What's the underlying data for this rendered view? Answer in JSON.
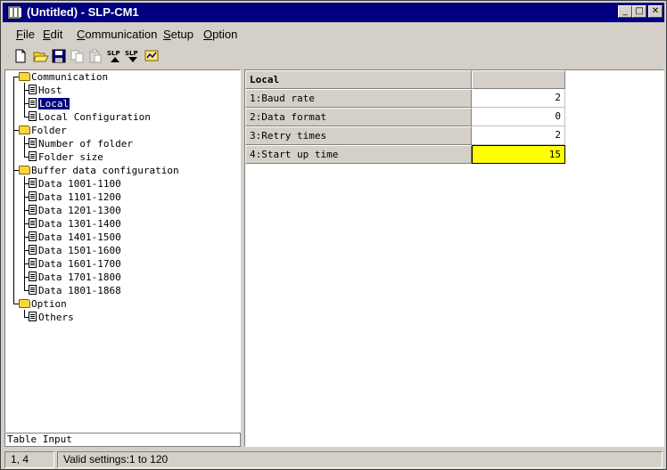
{
  "window": {
    "title": "(Untitled) - SLP-CM1",
    "app_icon": "app-icon",
    "buttons": {
      "minimize": "_",
      "maximize": "□",
      "close": "✕"
    }
  },
  "menu": {
    "items": [
      {
        "accel": "F",
        "rest": "ile"
      },
      {
        "accel": "E",
        "rest": "dit"
      },
      {
        "accel": "C",
        "rest": "ommunication"
      },
      {
        "accel": "S",
        "rest": "etup"
      },
      {
        "accel": "O",
        "rest": "ption"
      }
    ]
  },
  "toolbar": {
    "icons": [
      "new-file-icon",
      "open-folder-icon",
      "save-disk-icon",
      "copy-icon",
      "paste-icon",
      "slp-upload-icon",
      "slp-download-icon",
      "monitor-icon"
    ],
    "slp_label": "SLP"
  },
  "tree": {
    "communication": {
      "label": "Communication",
      "children": [
        "Host",
        "Local",
        "Local Configuration"
      ]
    },
    "folder": {
      "label": "Folder",
      "children": [
        "Number of folder",
        "Folder size"
      ]
    },
    "buffer": {
      "label": "Buffer data configuration",
      "children": [
        "Data 1001-1100",
        "Data 1101-1200",
        "Data 1201-1300",
        "Data 1301-1400",
        "Data 1401-1500",
        "Data 1501-1600",
        "Data 1601-1700",
        "Data 1701-1800",
        "Data 1801-1868"
      ]
    },
    "option": {
      "label": "Option",
      "children": [
        "Others"
      ]
    },
    "selected": "Local"
  },
  "tree_status": "Table Input",
  "table": {
    "title": "Local",
    "rows": [
      {
        "label": "1:Baud rate",
        "value": "2"
      },
      {
        "label": "2:Data format",
        "value": "0"
      },
      {
        "label": "3:Retry times",
        "value": "2"
      },
      {
        "label": "4:Start up time",
        "value": "15"
      }
    ],
    "active_row": 3,
    "active_color": "#ffff00"
  },
  "status": {
    "position": "1, 4",
    "message": "Valid settings:1 to 120"
  },
  "colors": {
    "titlebar": "#000080",
    "face": "#d4d0c8",
    "selection": "#000080"
  }
}
